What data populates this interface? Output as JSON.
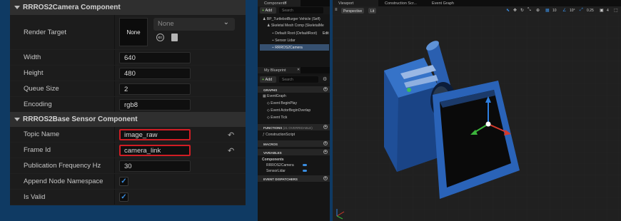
{
  "details": {
    "camera_section": "RRROS2Camera Component",
    "render_target": {
      "label": "Render Target",
      "thumb": "None",
      "dropdown": "None"
    },
    "fields": [
      {
        "label": "Width",
        "value": "640"
      },
      {
        "label": "Height",
        "value": "480"
      },
      {
        "label": "Queue Size",
        "value": "2"
      },
      {
        "label": "Encoding",
        "value": "rgb8"
      }
    ],
    "sensor_section": "RRROS2Base Sensor Component",
    "topic_name": {
      "label": "Topic Name",
      "value": "image_raw"
    },
    "frame_id": {
      "label": "Frame Id",
      "value": "camera_link"
    },
    "pub_freq": {
      "label": "Publication Frequency Hz",
      "value": "30"
    },
    "append_ns": {
      "label": "Append Node Namespace"
    },
    "is_valid": {
      "label": "Is Valid"
    }
  },
  "components_panel": {
    "tab": "Components",
    "add_label": "Add",
    "search_placeholder": "Search",
    "tree": [
      "BP_TurtlebotBurger Vehicle (Self)",
      "Skeletal Mesh Comp (SkeletalMe",
      "Default Root (DefaultRoot)",
      "Sensor Lidar",
      "RRROS2Camera"
    ],
    "edit_label": "Edit"
  },
  "my_blueprint": {
    "tab": "My Blueprint",
    "add_label": "Add",
    "search_placeholder": "Search",
    "graphs_label": "GRAPHS",
    "event_graph": "EventGraph",
    "events": [
      "Event BeginPlay",
      "Event ActorBeginOverlap",
      "Event Tick"
    ],
    "functions_label": "FUNCTIONS",
    "functions_count": "(21 OVERRIDABLE)",
    "construction_script": "ConstructionScript",
    "macros_label": "MACROS",
    "variables_label": "VARIABLES",
    "components_label": "Components",
    "vars": [
      "RRROS2Camera",
      "SensorLidar"
    ],
    "dispatchers_label": "EVENT DISPATCHERS"
  },
  "viewport": {
    "tabs": [
      "Viewport",
      "Construction Scr...",
      "Event Graph"
    ],
    "perspective": "Perspective",
    "lit": "Lit",
    "snap_values": [
      "10",
      "10°",
      "0.25",
      "4"
    ]
  },
  "colors": {
    "highlight_red": "#d01d24",
    "accent_blue": "#3a8de0",
    "background_blue": "#0f3a63"
  }
}
